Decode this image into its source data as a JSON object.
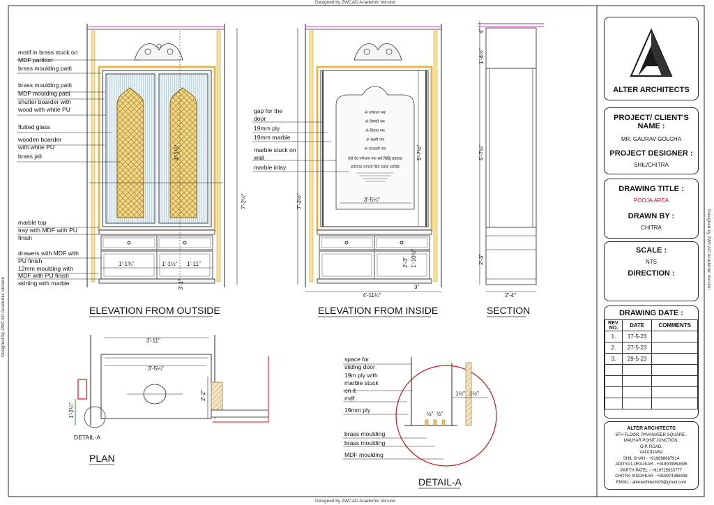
{
  "watermarks": {
    "top": "Designed by ZWCAD Academic Version",
    "bottom": "Designed by ZWCAD Academic Version",
    "left": "Designed by ZWCAD Academic Version",
    "right": "Designed by ZWCAD Academic Version"
  },
  "views": {
    "outside": "ELEVATION FROM OUTSIDE",
    "inside": "ELEVATION FROM INSIDE",
    "section": "SECTION",
    "plan": "PLAN",
    "detail": "DETAIL-A",
    "detail_tag": "DETAIL-A"
  },
  "outside_labels": [
    "motif in brass stuck on",
    "MDF partiton",
    "brass moulding patti",
    "brass moulding patti",
    "MDF moulding patti",
    "shutter boarder with",
    "wood with white PU",
    "flutted glass",
    "wooden boarder",
    "with white PU",
    "brass jali",
    "marble top",
    "tray with MDF with PU",
    "finish",
    "drawers with MDF with",
    "PU finish",
    "12mm moulding with",
    "MDF with PU finish",
    "skirting with marble"
  ],
  "inside_labels": [
    "gap for the",
    "door",
    "19mm ply",
    "19mm marble",
    "marble stuck on",
    "wall",
    "marble inlay"
  ],
  "detail_labels": [
    "space for",
    "sliding door",
    "19m ply with",
    "marble stuck",
    "on it",
    "mdf",
    "19mm ply",
    "brass moulding",
    "brass moulding",
    "MDF moulding"
  ],
  "dims": {
    "out_height": "7'-2½\"",
    "out_top": "4'-1½\"",
    "out_base": "3'-1\"",
    "out_w1": "1'-1¾\"",
    "out_w2": "1'-1½\"",
    "out_w3": "1'-11\"",
    "in_height": "7'-2½\"",
    "in_width": "4'-11¼\"",
    "in_marble": "3'-5¼\"",
    "in_right": "5'-7½\"",
    "in_low1": "2'-3\"",
    "in_low2": "1'-10½\"",
    "in_low3": "3\"",
    "sec_top": "4\"",
    "sec_h1": "1'-4½\"",
    "sec_h2": "5'-7½\"",
    "sec_h3": "2'-3\"",
    "sec_w": "2'-4\"",
    "plan_w1": "3'-11\"",
    "plan_w2": "3'-5¼\"",
    "plan_d": "2'-2\"",
    "plan_side": "1'-2¼\"",
    "det_1": "1½\"",
    "det_2": "1½\"",
    "det_3": "½\"",
    "det_4": "½\""
  },
  "mantra_lines": [
    "ॐ गणेशाय नमः",
    "ॐ विष्णवे नमः",
    "ॐ शिवाय नमः",
    "ॐ लक्ष्म्यै नमः",
    "ॐ सरस्वत्यै नमः",
    "देवो देव गणेशाय नमः सर्व सिद्धि प्रदायक",
    "सर्वमंगल मांगल्ये शिवे सर्वार्थ साधिके"
  ],
  "title_block": {
    "firm": "ALTER ARCHITECTS",
    "client_h": "PROJECT/ CLIENT'S NAME :",
    "client_v": "MR. GAURAV GOLCHA",
    "designer_h": "PROJECT DESIGNER :",
    "designer_v": "SHIL/CHITRA",
    "drawing_title_h": "DRAWING TITLE :",
    "drawing_title_v": "POOJA AREA",
    "drawn_by_h": "DRAWN BY :",
    "drawn_by_v": "CHITRA",
    "scale_h": "SCALE :",
    "scale_v": "NTS",
    "direction_h": "DIRECTION :",
    "date_h": "DRAWING DATE :",
    "col_rev": "REV. NO.",
    "col_date": "DATE",
    "col_comments": "COMMENTS",
    "revisions": [
      {
        "no": "1.",
        "date": "17-5-23",
        "comments": ""
      },
      {
        "no": "2.",
        "date": "27-5-23",
        "comments": ""
      },
      {
        "no": "3.",
        "date": "29-5-23",
        "comments": ""
      }
    ],
    "contact": [
      "ALTER ARCHITECTS",
      "6TH FLOOR, PAVANVEER SQUARE ,",
      "MALHAR POINT JUNCTION,",
      "O.P. ROAD,",
      "VADODARA",
      "SHIL SHAH - +919898687914",
      "ADITYA LIJRAJKAR - +919909962896",
      "PARTH PATEL - +919725933777",
      "CHITRA SINDHKAR - +919974368438",
      "EMAIL - alterarchitects09@gmail.com"
    ]
  },
  "colors": {
    "brass": "#e8c66a",
    "jali": "#d8b24a",
    "glass": "#dfeef3",
    "magenta": "#c34bc9",
    "red": "#c0161b",
    "green": "#1a9a2a",
    "line": "#1a1a1a"
  }
}
